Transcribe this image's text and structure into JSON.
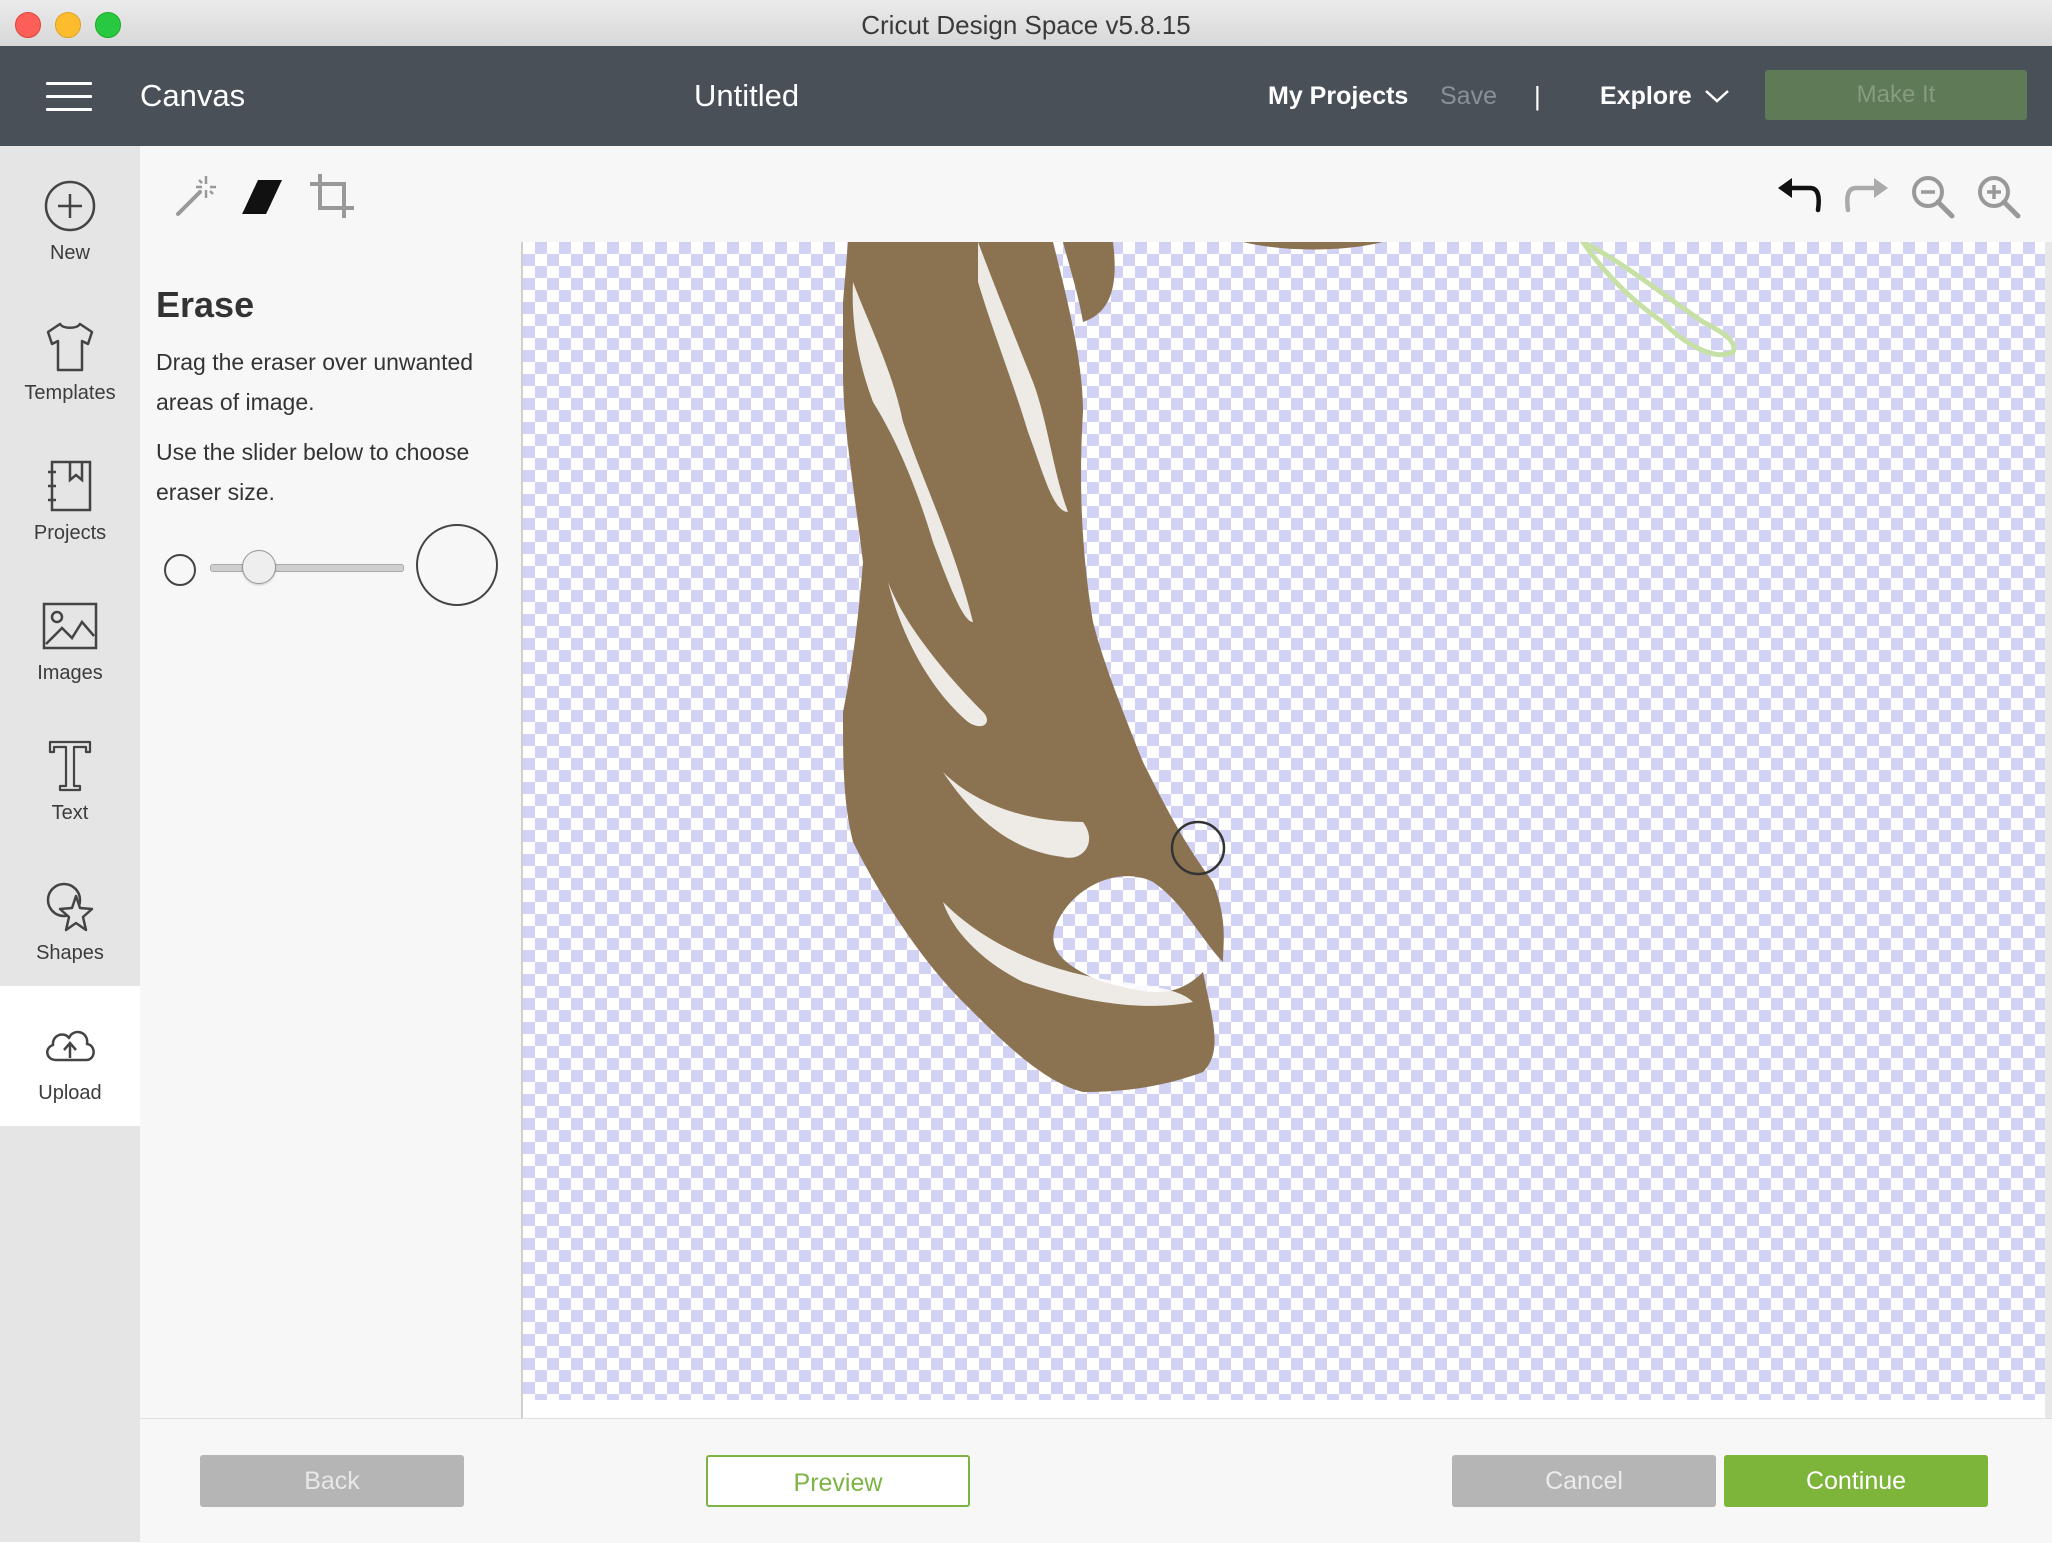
{
  "window": {
    "title": "Cricut Design Space  v5.8.15"
  },
  "header": {
    "section": "Canvas",
    "doc_title": "Untitled",
    "my_projects": "My Projects",
    "save": "Save",
    "divider": "|",
    "explore": "Explore",
    "make_it": "Make It"
  },
  "sidebar": {
    "items": [
      {
        "label": "New",
        "icon": "plus-circle-icon"
      },
      {
        "label": "Templates",
        "icon": "tshirt-icon"
      },
      {
        "label": "Projects",
        "icon": "projects-book-icon"
      },
      {
        "label": "Images",
        "icon": "image-icon"
      },
      {
        "label": "Text",
        "icon": "text-t-icon"
      },
      {
        "label": "Shapes",
        "icon": "shapes-icon"
      },
      {
        "label": "Upload",
        "icon": "cloud-upload-icon"
      }
    ],
    "active": "Upload"
  },
  "toolbar": {
    "left_tools": [
      "magic-wand-icon",
      "eraser-icon",
      "crop-icon"
    ],
    "right_tools": [
      "undo-icon",
      "redo-icon",
      "zoom-out-icon",
      "zoom-in-icon"
    ],
    "active_tool": "eraser"
  },
  "panel": {
    "title": "Erase",
    "instruction1": "Drag the eraser over unwanted areas of image.",
    "instruction2": "Use the slider below to choose eraser size.",
    "eraser_size_fraction": 0.2
  },
  "canvas": {
    "image_color": "#8b7351",
    "checker_color": "#d2d2f5"
  },
  "footer": {
    "back": "Back",
    "preview": "Preview",
    "cancel": "Cancel",
    "continue": "Continue"
  },
  "colors": {
    "header_bg": "#4a5058",
    "accent_green": "#7db43a"
  }
}
